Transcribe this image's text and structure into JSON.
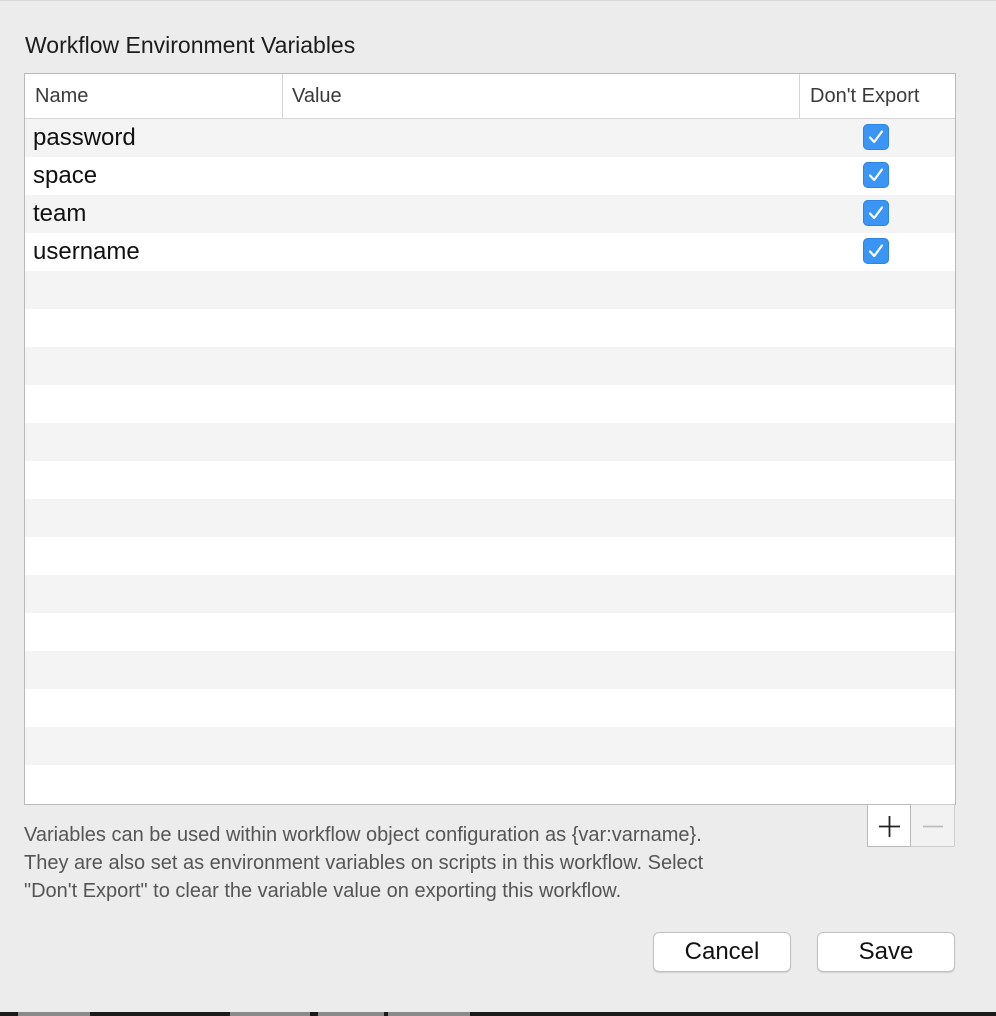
{
  "dialog": {
    "title": "Workflow Environment Variables"
  },
  "table": {
    "columns": [
      "Name",
      "Value",
      "Don't Export"
    ],
    "rows": [
      {
        "name": "password",
        "value": "",
        "dont_export": true
      },
      {
        "name": "space",
        "value": "",
        "dont_export": true
      },
      {
        "name": "team",
        "value": "",
        "dont_export": true
      },
      {
        "name": "username",
        "value": "",
        "dont_export": true
      }
    ]
  },
  "controls": {
    "add_icon": "plus-icon",
    "remove_icon": "minus-icon",
    "remove_enabled": false
  },
  "help_text": [
    "Variables can be used within workflow object configuration as {var:varname}.",
    "They are also set as environment variables on scripts in this workflow. Select",
    "\"Don't Export\" to clear the variable value on exporting this workflow."
  ],
  "buttons": {
    "cancel": "Cancel",
    "save": "Save"
  },
  "colors": {
    "checkbox_accent": "#3b95f5",
    "stripe": "#f4f4f4"
  }
}
